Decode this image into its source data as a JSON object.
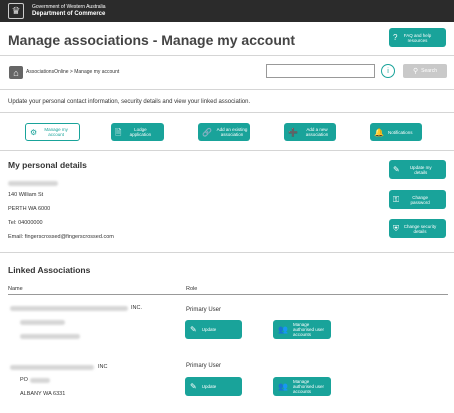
{
  "header": {
    "crest_icon": "coat-of-arms-icon",
    "gov_line1": "Government of Western Australia",
    "gov_line2": "Department of Commerce"
  },
  "page": {
    "title": "Manage associations - Manage my account",
    "faq_label": "FAQ and help resources",
    "faq_icon": "question-icon"
  },
  "breadcrumb": {
    "home_icon": "home-icon",
    "root": "AssociationsOnline",
    "separator": " > ",
    "current": "Manage my account"
  },
  "search": {
    "value": "",
    "placeholder": "",
    "info_icon": "info-icon",
    "button_label": "Search",
    "button_icon": "search-icon"
  },
  "intro": "Update your personal contact information, security details and view your linked association.",
  "nav": [
    {
      "label": "Manage my account",
      "icon": "gear-icon"
    },
    {
      "label": "Lodge application",
      "icon": "document-icon"
    },
    {
      "label": "Add an existing association",
      "icon": "link-icon"
    },
    {
      "label": "Add a new association",
      "icon": "add-icon"
    },
    {
      "label": "Notifications",
      "icon": "bell-icon"
    }
  ],
  "personal": {
    "title": "My personal details",
    "address1": "140 William St",
    "address2": "PERTH WA 6000",
    "tel": "Tel: 04000000",
    "email": "Email: fingerscrossed@fingerscrossed.com",
    "buttons": [
      {
        "label": "Update my details",
        "icon": "edit-icon"
      },
      {
        "label": "Change password",
        "icon": "key-icon"
      },
      {
        "label": "Change security details",
        "icon": "shield-icon"
      }
    ]
  },
  "linked": {
    "title": "Linked Associations",
    "col_name": "Name",
    "col_role": "Role",
    "rows": [
      {
        "name_suffix": "INC.",
        "address": "",
        "address2": "",
        "role": "Primary User",
        "update_label": "Update",
        "manage_label": "Manage authorised user accounts"
      },
      {
        "name_suffix": "INC",
        "address": "PO",
        "address2": "ALBANY WA 6331",
        "role": "Primary User",
        "update_label": "Update",
        "manage_label": "Manage authorised user accounts"
      }
    ]
  },
  "colors": {
    "accent": "#19a39a",
    "header_bg": "#2b2b2b",
    "disabled": "#c9c9c9"
  }
}
